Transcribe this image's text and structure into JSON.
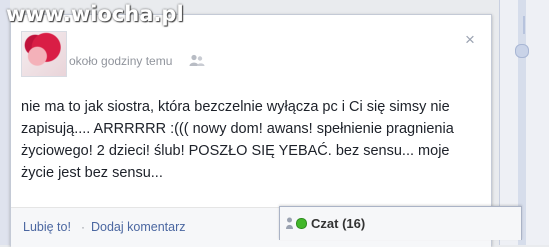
{
  "watermark": "www.wiocha.pl",
  "post": {
    "timestamp": "około godziny temu",
    "privacy_icon": "friends-icon",
    "close_label": "×",
    "text": "nie ma to jak siostra, która bezczelnie wyłącza pc i Ci się simsy nie zapisują.... ARRRRRR :((( nowy dom! awans! spełnienie pragnienia życiowego! 2 dzieci! ślub! POSZŁO SIĘ YEBAĆ. bez sensu... moje życie jest bez sensu..."
  },
  "actions": {
    "like_label": "Lubię to!",
    "separator": "·",
    "comment_label": "Dodaj komentarz"
  },
  "chat": {
    "label": "Czat",
    "count": "(16)",
    "status_color": "#42b72a"
  },
  "colors": {
    "link": "#4b67a1",
    "text": "#1d2129",
    "muted": "#90949c"
  }
}
